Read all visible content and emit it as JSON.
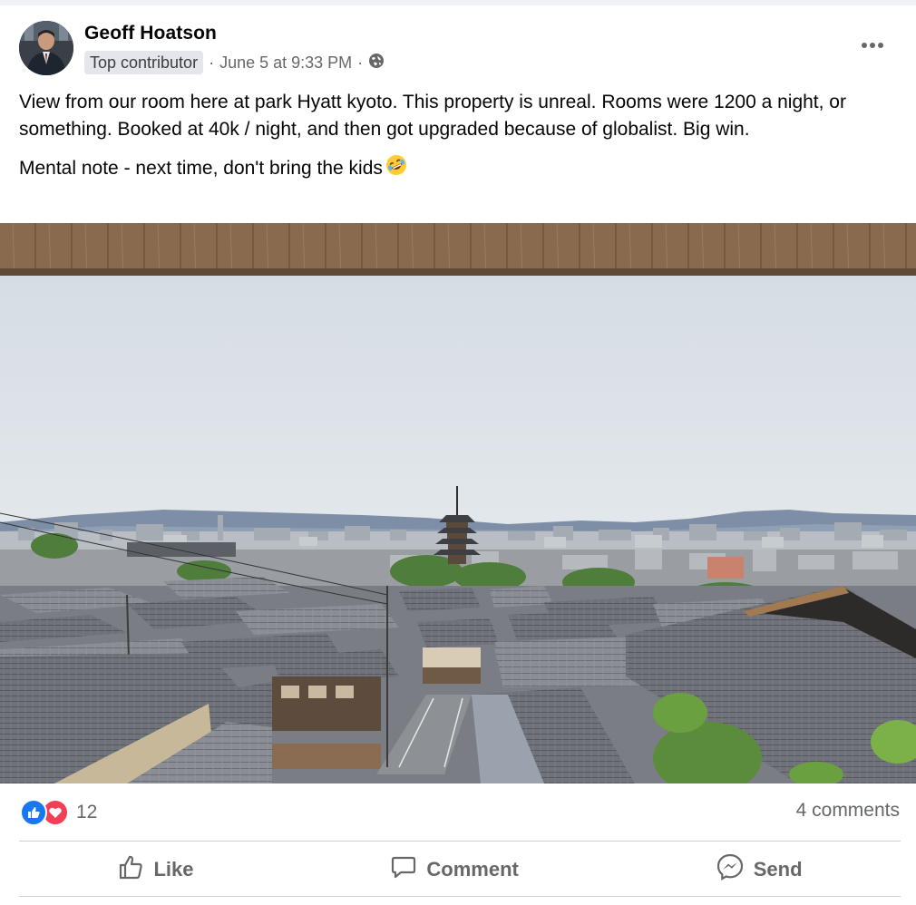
{
  "author": {
    "name": "Geoff Hoatson",
    "badge": "Top contributor",
    "timestamp": "June 5 at 9:33 PM",
    "audience_icon": "globe-icon"
  },
  "post": {
    "paragraph1": "View from our room here at park Hyatt kyoto. This property is unreal.  Rooms were 1200 a night, or something. Booked at 40k / night, and then got upgraded because of globalist. Big win.",
    "paragraph2": "Mental note - next time, don't bring the kids",
    "emoji": "rolling-on-floor-laughing-emoji"
  },
  "reactions": {
    "icons": [
      "like-icon",
      "love-icon"
    ],
    "count": "12",
    "comments": "4 comments"
  },
  "actions": {
    "like": "Like",
    "comment": "Comment",
    "send": "Send"
  },
  "colors": {
    "like_blue": "#1877f2",
    "love_red": "#f33e58",
    "muted_text": "#65676b",
    "badge_bg": "#e4e6eb"
  }
}
